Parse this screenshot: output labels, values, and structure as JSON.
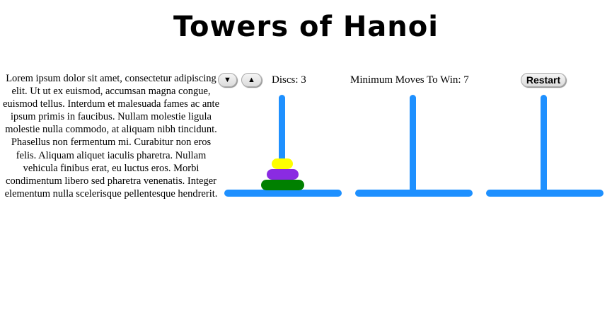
{
  "title": "Towers of Hanoi",
  "description": "Lorem ipsum dolor sit amet, consectetur adipiscing elit. Ut ut ex euismod, accumsan magna congue, euismod tellus. Interdum et malesuada fames ac ante ipsum primis in faucibus. Nullam molestie ligula molestie nulla commodo, at aliquam nibh tincidunt. Phasellus non fermentum mi. Curabitur non eros felis. Aliquam aliquet iaculis pharetra. Nullam vehicula finibus erat, eu luctus eros. Morbi condimentum libero sed pharetra venenatis. Integer elementum nulla scelerisque pellentesque hendrerit.",
  "controls": {
    "decrease_label": "▼",
    "increase_label": "▲",
    "discs_text": "Discs: 3",
    "min_moves_text": "Minimum Moves To Win: 7",
    "restart_label": "Restart"
  },
  "colors": {
    "tower": "#1e90ff",
    "disc_small": "#ffff00",
    "disc_medium": "#8a2be2",
    "disc_large": "#008000"
  },
  "towers": [
    {
      "discs": [
        "large",
        "medium",
        "small"
      ]
    },
    {
      "discs": []
    },
    {
      "discs": []
    }
  ]
}
